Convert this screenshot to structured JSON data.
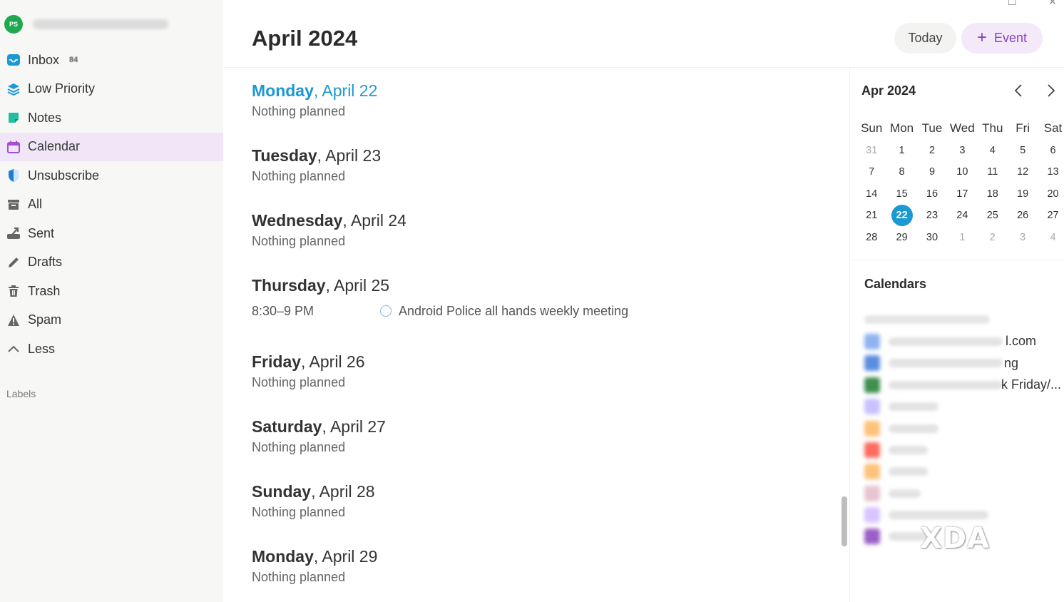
{
  "sidebar": {
    "avatar_initials": "PS",
    "items": [
      {
        "label": "Inbox",
        "badge": "84",
        "icon": "inbox-icon",
        "color": "#1c98d3"
      },
      {
        "label": "Low Priority",
        "icon": "layers-icon",
        "color": "#1c98d3"
      },
      {
        "label": "Notes",
        "icon": "note-icon",
        "color": "#1fbf9f"
      },
      {
        "label": "Calendar",
        "icon": "calendar-icon",
        "color": "#a44fd1",
        "active": true
      },
      {
        "label": "Unsubscribe",
        "icon": "shield-icon",
        "color": "#1c7fd3"
      },
      {
        "label": "All",
        "icon": "archive-icon",
        "color": "#666666"
      },
      {
        "label": "Sent",
        "icon": "sent-icon",
        "color": "#666666"
      },
      {
        "label": "Drafts",
        "icon": "pencil-icon",
        "color": "#666666"
      },
      {
        "label": "Trash",
        "icon": "trash-icon",
        "color": "#666666"
      },
      {
        "label": "Spam",
        "icon": "warning-icon",
        "color": "#666666"
      },
      {
        "label": "Less",
        "icon": "chevron-up-icon",
        "color": "#666666"
      }
    ],
    "labels_heading": "Labels"
  },
  "header": {
    "title": "April 2024",
    "today_label": "Today",
    "event_label": "Event",
    "event_icon": "plus-icon"
  },
  "agenda": [
    {
      "day": "Monday",
      "date": ", April 22",
      "sub": "Nothing planned",
      "today": true
    },
    {
      "day": "Tuesday",
      "date": ", April 23",
      "sub": "Nothing planned"
    },
    {
      "day": "Wednesday",
      "date": ", April 24",
      "sub": "Nothing planned"
    },
    {
      "day": "Thursday",
      "date": ", April 25",
      "event_time": "8:30–9 PM",
      "event_title": "Android Police all hands weekly meeting"
    },
    {
      "day": "Friday",
      "date": ", April 26",
      "sub": "Nothing planned"
    },
    {
      "day": "Saturday",
      "date": ", April 27",
      "sub": "Nothing planned"
    },
    {
      "day": "Sunday",
      "date": ", April 28",
      "sub": "Nothing planned"
    },
    {
      "day": "Monday",
      "date": ", April 29",
      "sub": "Nothing planned"
    }
  ],
  "mini_calendar": {
    "title": "Apr 2024",
    "weekdays": [
      "Sun",
      "Mon",
      "Tue",
      "Wed",
      "Thu",
      "Fri",
      "Sat"
    ],
    "weeks": [
      [
        "31",
        "1",
        "2",
        "3",
        "4",
        "5",
        "6"
      ],
      [
        "7",
        "8",
        "9",
        "10",
        "11",
        "12",
        "13"
      ],
      [
        "14",
        "15",
        "16",
        "17",
        "18",
        "19",
        "20"
      ],
      [
        "21",
        "22",
        "23",
        "24",
        "25",
        "26",
        "27"
      ],
      [
        "28",
        "29",
        "30",
        "1",
        "2",
        "3",
        "4"
      ]
    ],
    "selected": "22",
    "accent": "#1c98d3"
  },
  "calendars": {
    "heading": "Calendars",
    "visible_tails": [
      "l.com",
      "ng",
      "k Friday/..."
    ],
    "swatches": [
      "#8fb3f0",
      "#5a8ee0",
      "#3f8f4f",
      "#c9c2ff",
      "#ffc27a",
      "#ff6b5e",
      "#ffc27a",
      "#e8c4cf",
      "#d9c4ff",
      "#9a5fc7"
    ]
  },
  "watermark": "XDA"
}
